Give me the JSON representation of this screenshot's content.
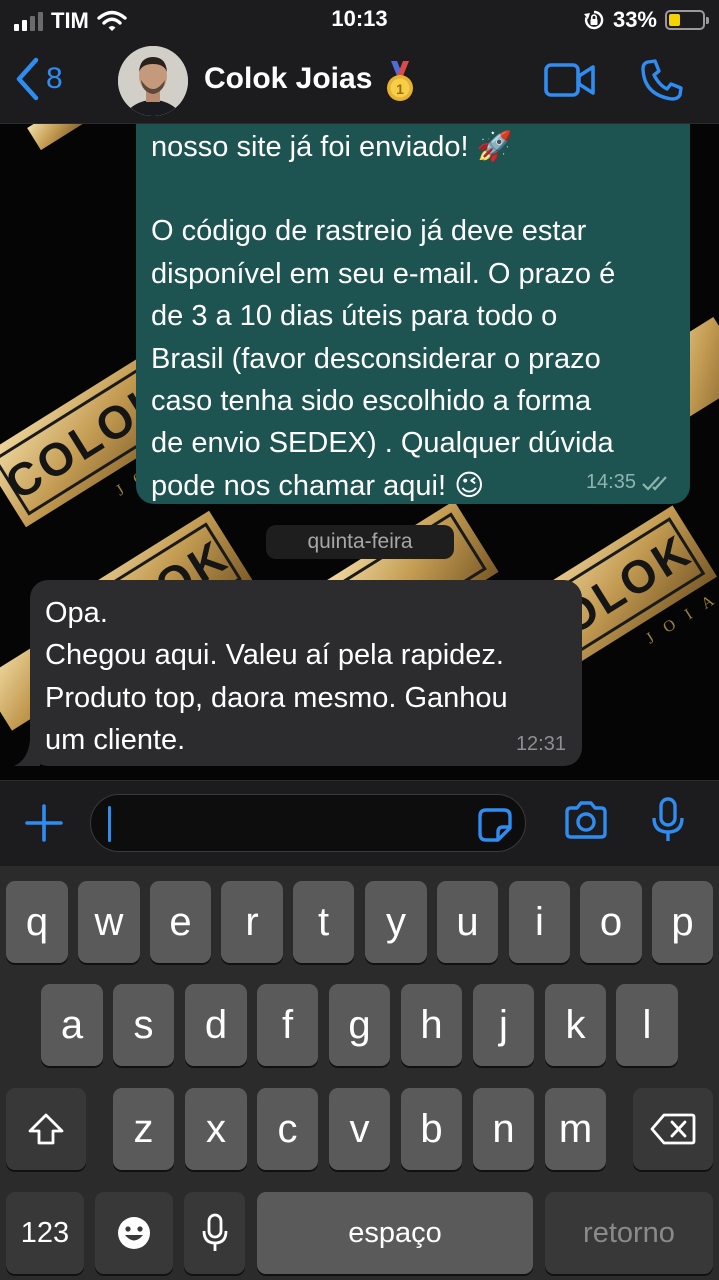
{
  "status_bar": {
    "carrier": "TIM",
    "time": "10:13",
    "battery_percent": "33%",
    "battery_level": 0.33,
    "battery_color": "#f5d300",
    "icons": [
      "cellular-signal-icon",
      "wifi-icon",
      "orientation-lock-icon",
      "battery-icon"
    ]
  },
  "header": {
    "back_count": "8",
    "contact_name": "Colok Joias",
    "badge_icon": "gold-medal-icon",
    "accent_color": "#2f8cf0",
    "actions": [
      "video-call-icon",
      "phone-call-icon"
    ]
  },
  "chat": {
    "wallpaper_text": [
      "COLOK",
      "COLOK",
      "COLOK",
      "JOIAS",
      "JOIAS"
    ],
    "outgoing": {
      "text_top": "nosso site já foi enviado! 🚀",
      "text_body": "O código de rastreio já deve estar\ndisponível em seu e-mail. O prazo é\nde 3 a 10 dias úteis para todo o\nBrasil (favor desconsiderar o prazo\ncaso tenha sido escolhido a forma\nde envio SEDEX) . Qualquer dúvida\npode nos chamar aqui! 😉",
      "time": "14:35",
      "bubble_color": "#1d5350"
    },
    "date_separator": "quinta-feira",
    "incoming": {
      "text": "Opa.\nChegou aqui. Valeu aí pela rapidez.\nProduto top, daora mesmo. Ganhou\num cliente.",
      "time": "12:31",
      "bubble_color": "#2c2c2e"
    }
  },
  "composer": {
    "value": "",
    "icons": [
      "plus-icon",
      "sticker-icon",
      "camera-icon",
      "microphone-icon"
    ]
  },
  "keyboard": {
    "row1": [
      "q",
      "w",
      "e",
      "r",
      "t",
      "y",
      "u",
      "i",
      "o",
      "p"
    ],
    "row2": [
      "a",
      "s",
      "d",
      "f",
      "g",
      "h",
      "j",
      "k",
      "l"
    ],
    "row3": [
      "z",
      "x",
      "c",
      "v",
      "b",
      "n",
      "m"
    ],
    "numbers_key": "123",
    "space_key": "espaço",
    "return_key": "retorno",
    "icons": [
      "shift-icon",
      "backspace-icon",
      "emoji-icon",
      "dictation-icon"
    ]
  }
}
